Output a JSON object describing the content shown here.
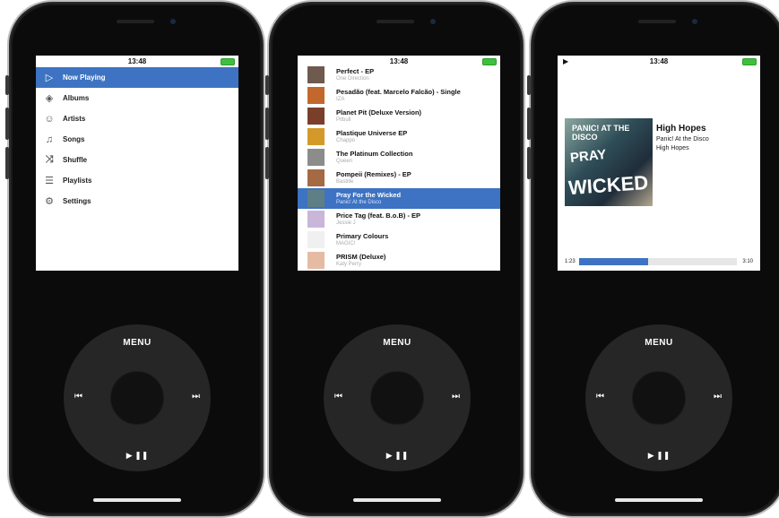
{
  "status": {
    "time": "13:48"
  },
  "menu": {
    "items": [
      {
        "label": "Now Playing",
        "icon": "play-outline-icon",
        "selected": true
      },
      {
        "label": "Albums",
        "icon": "albums-stack-icon",
        "selected": false
      },
      {
        "label": "Artists",
        "icon": "people-icon",
        "selected": false
      },
      {
        "label": "Songs",
        "icon": "music-note-icon",
        "selected": false
      },
      {
        "label": "Shuffle",
        "icon": "shuffle-icon",
        "selected": false
      },
      {
        "label": "Playlists",
        "icon": "list-icon",
        "selected": false
      },
      {
        "label": "Settings",
        "icon": "gear-icon",
        "selected": false
      }
    ]
  },
  "songs": [
    {
      "title": "Perfect - EP",
      "artist": "One Direction",
      "color": "#6e5a4e"
    },
    {
      "title": "Pesadão (feat. Marcelo Falcão) - Single",
      "artist": "IZA",
      "color": "#c3682d"
    },
    {
      "title": "Planet Pit (Deluxe Version)",
      "artist": "Pitbull",
      "color": "#7a3f2a"
    },
    {
      "title": "Plastique Universe EP",
      "artist": "Chappo",
      "color": "#d39a2a"
    },
    {
      "title": "The Platinum Collection",
      "artist": "Queen",
      "color": "#8c8c8c"
    },
    {
      "title": "Pompeii (Remixes) - EP",
      "artist": "Bastille",
      "color": "#a36a44"
    },
    {
      "title": "Pray For the Wicked",
      "artist": "Panic! At the Disco",
      "color": "#5f7f86",
      "selected": true
    },
    {
      "title": "Price Tag (feat. B.o.B) - EP",
      "artist": "Jessie J",
      "color": "#c9b6d9"
    },
    {
      "title": "Primary Colours",
      "artist": "MAGIC!",
      "color": "#f0f0f0"
    },
    {
      "title": "PRISM (Deluxe)",
      "artist": "Katy Perry",
      "color": "#e5bca3"
    }
  ],
  "now_playing": {
    "title": "High Hopes",
    "artist": "Panic! At the Disco",
    "album": "High Hopes",
    "art_text_1": "PANIC! AT THE DISCO",
    "art_text_2": "PRAY",
    "art_text_3": "WICKED",
    "current_time": "1:23",
    "total_time": "3:10",
    "progress": 0.44,
    "play_indicator": "▶"
  },
  "wheel": {
    "menu_label": "MENU",
    "prev": "⏮",
    "next": "⏭",
    "play_pause": "▶ ❚❚"
  },
  "colors": {
    "accent": "#3d73c2",
    "battery": "#3fbf3f"
  }
}
